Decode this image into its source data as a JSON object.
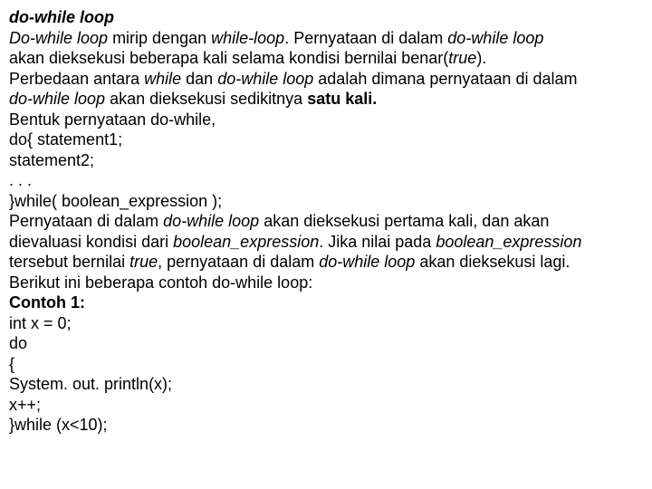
{
  "lines": [
    {
      "segments": [
        {
          "text": "do-while loop",
          "cls": "bi"
        }
      ]
    },
    {
      "segments": [
        {
          "text": "Do-while loop",
          "cls": "i"
        },
        {
          "text": " mirip dengan ",
          "cls": ""
        },
        {
          "text": "while-loop",
          "cls": "i"
        },
        {
          "text": ". Pernyataan di dalam ",
          "cls": ""
        },
        {
          "text": "do-while loop",
          "cls": "i"
        }
      ]
    },
    {
      "segments": [
        {
          "text": "akan dieksekusi beberapa kali selama kondisi bernilai benar(",
          "cls": ""
        },
        {
          "text": "true",
          "cls": "i"
        },
        {
          "text": ").",
          "cls": ""
        }
      ]
    },
    {
      "segments": [
        {
          "text": "Perbedaan antara ",
          "cls": ""
        },
        {
          "text": "while ",
          "cls": "i"
        },
        {
          "text": "dan ",
          "cls": ""
        },
        {
          "text": "do-while loop ",
          "cls": "i"
        },
        {
          "text": "adalah dimana pernyataan di dalam",
          "cls": ""
        }
      ]
    },
    {
      "segments": [
        {
          "text": "do-while loop ",
          "cls": "i"
        },
        {
          "text": "akan dieksekusi sedikitnya ",
          "cls": ""
        },
        {
          "text": "satu kali.",
          "cls": "b"
        }
      ]
    },
    {
      "segments": [
        {
          "text": "Bentuk pernyataan do-while,",
          "cls": ""
        }
      ]
    },
    {
      "segments": [
        {
          "text": "do{ statement1;",
          "cls": ""
        }
      ]
    },
    {
      "segments": [
        {
          "text": "statement2;",
          "cls": ""
        }
      ]
    },
    {
      "segments": [
        {
          "text": ". . .",
          "cls": ""
        }
      ]
    },
    {
      "segments": [
        {
          "text": "}while( boolean_expression );",
          "cls": ""
        }
      ]
    },
    {
      "segments": [
        {
          "text": "Pernyataan di dalam ",
          "cls": ""
        },
        {
          "text": "do-while loop ",
          "cls": "i"
        },
        {
          "text": "akan dieksekusi pertama kali, dan akan",
          "cls": ""
        }
      ]
    },
    {
      "segments": [
        {
          "text": "dievaluasi kondisi dari ",
          "cls": ""
        },
        {
          "text": "boolean_expression",
          "cls": "i"
        },
        {
          "text": ". Jika nilai pada ",
          "cls": ""
        },
        {
          "text": "boolean_expression",
          "cls": "i"
        }
      ]
    },
    {
      "segments": [
        {
          "text": "tersebut bernilai ",
          "cls": ""
        },
        {
          "text": "true",
          "cls": "i"
        },
        {
          "text": ", pernyataan di dalam ",
          "cls": ""
        },
        {
          "text": "do-while loop ",
          "cls": "i"
        },
        {
          "text": "akan dieksekusi lagi.",
          "cls": ""
        }
      ]
    },
    {
      "segments": [
        {
          "text": "Berikut ini beberapa contoh do-while loop:",
          "cls": ""
        }
      ]
    },
    {
      "segments": [
        {
          "text": "Contoh 1:",
          "cls": "b"
        }
      ]
    },
    {
      "segments": [
        {
          "text": "int x = 0;",
          "cls": ""
        }
      ]
    },
    {
      "segments": [
        {
          "text": "do",
          "cls": ""
        }
      ]
    },
    {
      "segments": [
        {
          "text": "{",
          "cls": ""
        }
      ]
    },
    {
      "segments": [
        {
          "text": "System. out. println(x);",
          "cls": ""
        }
      ]
    },
    {
      "segments": [
        {
          "text": "x++;",
          "cls": ""
        }
      ]
    },
    {
      "segments": [
        {
          "text": "}while (x<10);",
          "cls": ""
        }
      ]
    }
  ]
}
